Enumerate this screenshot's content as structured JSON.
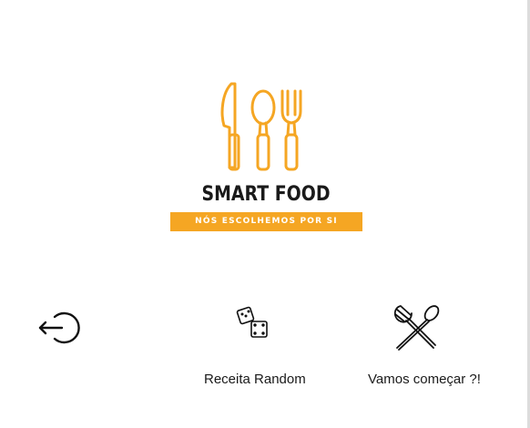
{
  "app": {
    "logo": {
      "title": "SMART FOOD",
      "tagline": "NÓS ESCOLHEMOS POR SI",
      "accent_color": "#f5a623",
      "icon": "knife-spoon-fork-icon"
    }
  },
  "actions": {
    "logout": {
      "icon": "logout-icon"
    },
    "random": {
      "icon": "dice-icon",
      "label": "Receita Random"
    },
    "start": {
      "icon": "crossed-utensils-icon",
      "label": "Vamos começar ?!"
    }
  }
}
